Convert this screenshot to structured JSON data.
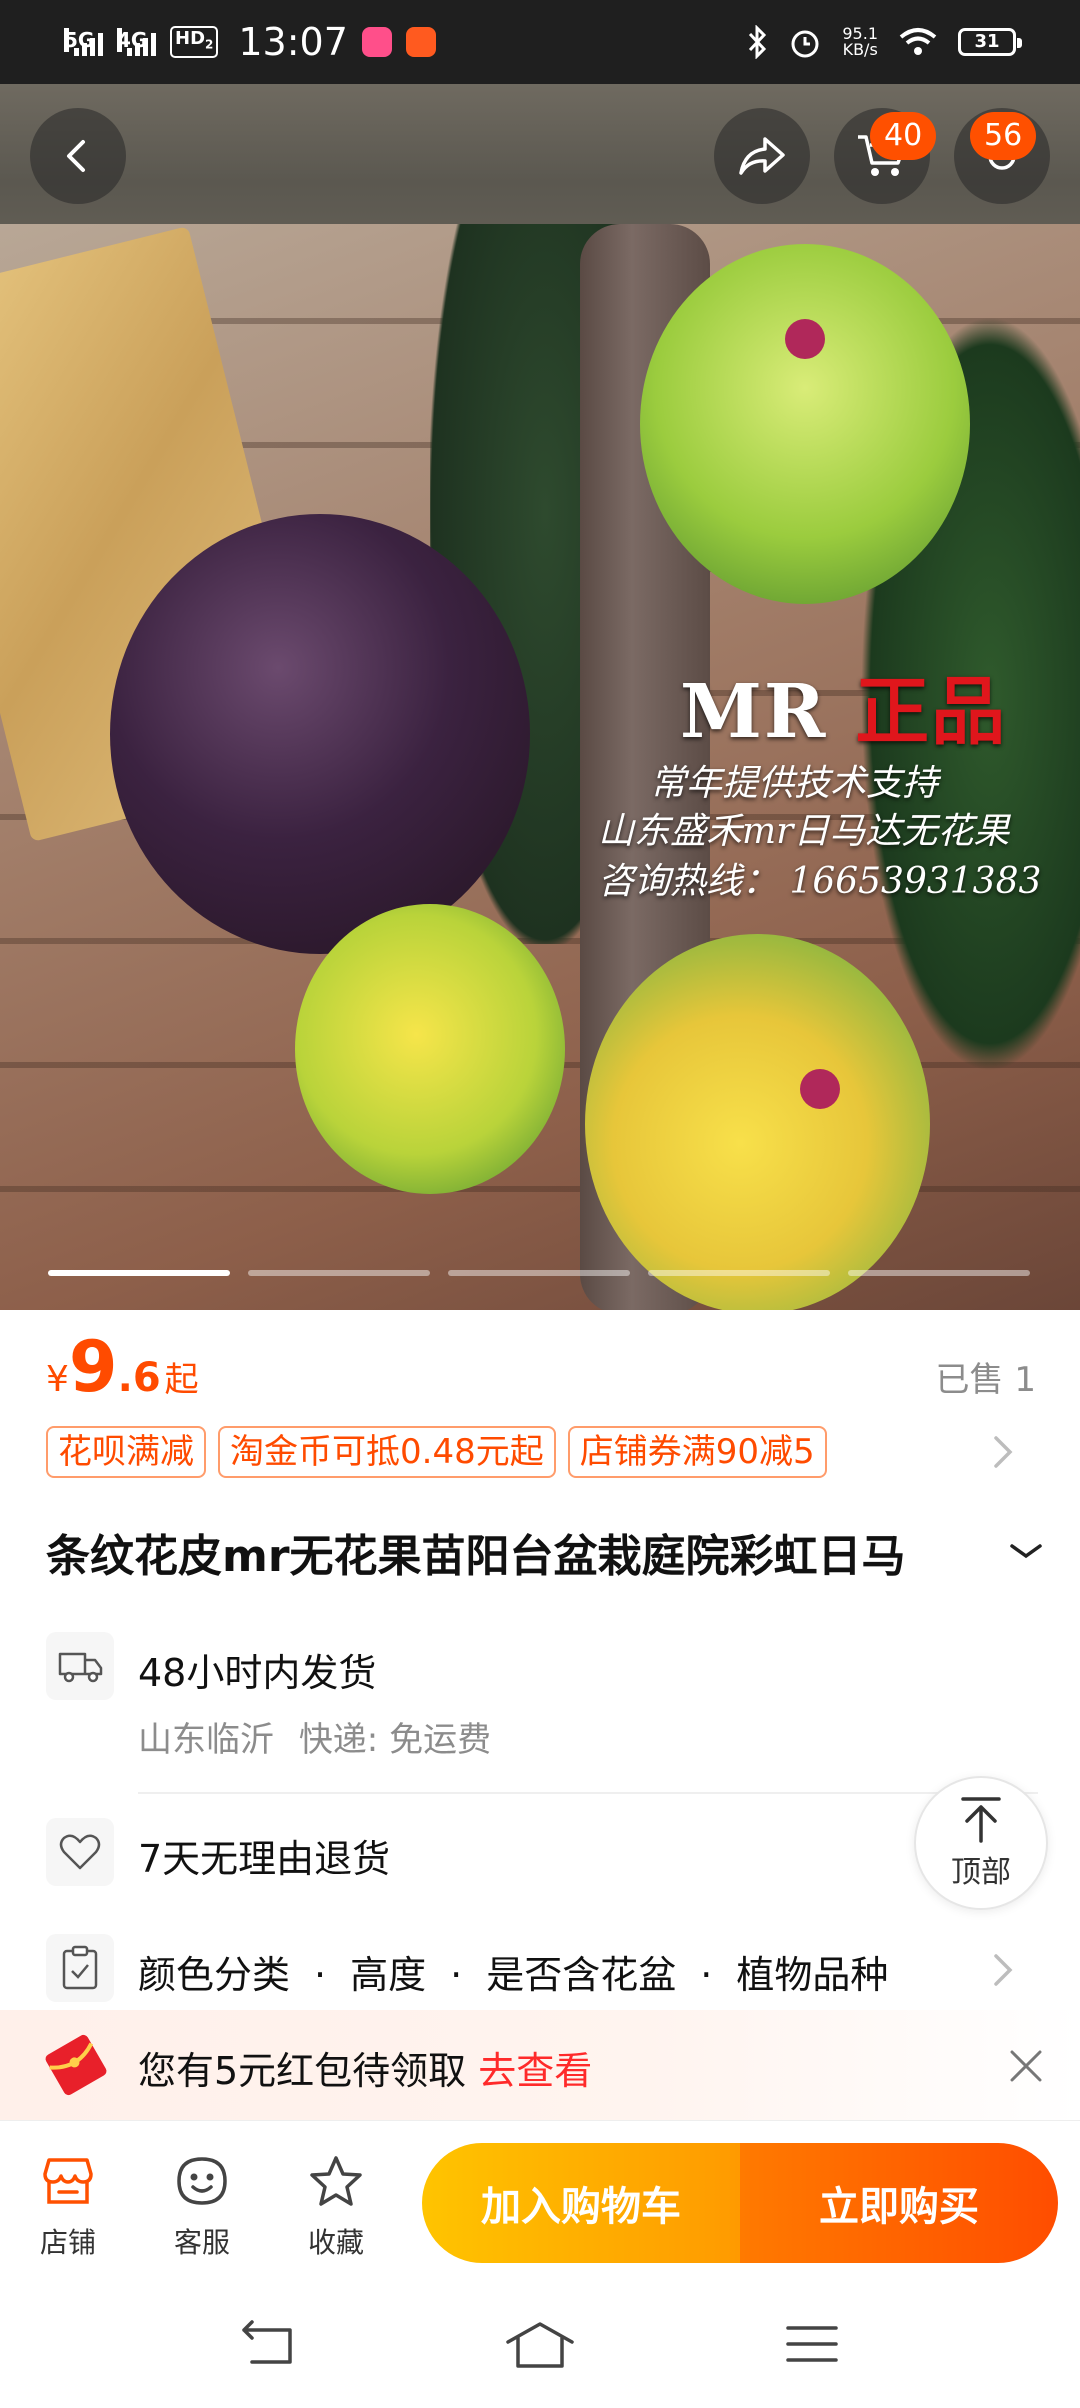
{
  "status_bar": {
    "sig1_label": "5G",
    "sig2_label": "4G",
    "hd_label": "HD",
    "hd_sub": "2",
    "time": "13:07",
    "net_speed_value": "95.1",
    "net_speed_unit": "KB/s",
    "battery": "31"
  },
  "header": {
    "cart_badge": "40",
    "more_badge": "56"
  },
  "hero": {
    "title_prefix": "MR",
    "title_red": "正品",
    "line1": "常年提供技术支持",
    "line2": "山东盛禾mr日马达无花果",
    "line3": "咨询热线： 16653931383",
    "slides": 5,
    "active_slide": 1
  },
  "product": {
    "price_currency": "¥",
    "price_int": "9",
    "price_dec": ".6",
    "price_suffix": "起",
    "sold": "已售 1",
    "tags": [
      "花呗满减",
      "淘金币可抵0.48元起",
      "店铺券满90减5"
    ],
    "title": "条纹花皮mr无花果苗阳台盆栽庭院彩虹日马"
  },
  "services": {
    "shipping_main": "48小时内发货",
    "shipping_origin": "山东临沂",
    "shipping_method": "快递: 免运费",
    "returns_main": "7天无理由退货",
    "options": [
      "颜色分类",
      "高度",
      "是否含花盆",
      "植物品种"
    ],
    "top_label": "顶部"
  },
  "banner": {
    "text": "您有5元红包待领取",
    "link": "去查看"
  },
  "action_bar": {
    "shop_label": "店铺",
    "service_label": "客服",
    "favorite_label": "收藏",
    "cart_label": "加入购物车",
    "buy_label": "立即购买"
  },
  "colors": {
    "accent": "#ff5000",
    "price": "#ff4b00",
    "cart_gradient_start": "#ffc400",
    "buy_gradient_end": "#ff4d00"
  }
}
